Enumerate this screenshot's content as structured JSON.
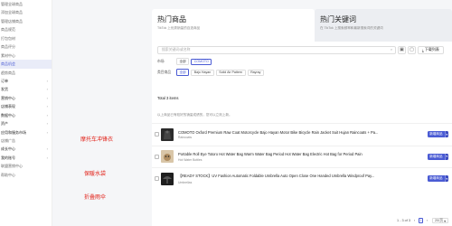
{
  "sidebar": {
    "items": [
      {
        "label": "管理全球商品",
        "type": "item"
      },
      {
        "label": "添加全球商品",
        "type": "item"
      },
      {
        "label": "管理店铺商品",
        "type": "item"
      },
      {
        "label": "商品规范",
        "type": "item"
      },
      {
        "label": "打包包材",
        "type": "item"
      },
      {
        "label": "商品评分",
        "type": "item"
      },
      {
        "label": "素材中心",
        "type": "item"
      },
      {
        "label": "商品机会",
        "type": "active"
      },
      {
        "label": "趋势商品",
        "type": "item"
      },
      {
        "label": "订单",
        "type": "group"
      },
      {
        "label": "发货",
        "type": "group"
      },
      {
        "label": "营销中心",
        "type": "group"
      },
      {
        "label": "店铺表现",
        "type": "group"
      },
      {
        "label": "数据中心",
        "type": "group"
      },
      {
        "label": "资产",
        "type": "group"
      },
      {
        "label": "应用和服务市场",
        "type": "group"
      },
      {
        "label": "店铺广告",
        "type": "item"
      },
      {
        "label": "成长中心",
        "type": "group"
      },
      {
        "label": "我的账号",
        "type": "group"
      },
      {
        "label": "联盟营销中心",
        "type": "item"
      },
      {
        "label": "帮助中心",
        "type": "item"
      }
    ]
  },
  "annotations": [
    "摩托车冲锋衣",
    "保暖水袋",
    "折叠雨伞"
  ],
  "tabs": [
    {
      "title": "热门商品",
      "subtitle": "TikTok 上优秀销量的自选商品"
    },
    {
      "title": "热门关键词",
      "subtitle": "在 TikTok 上搜索频率和最新搜索词的关键词"
    }
  ],
  "search": {
    "placeholder": "搜索关键词/或名称",
    "download_label": "下载列表"
  },
  "filters": [
    {
      "label": "市场",
      "chips": [
        {
          "text": "全部",
          "selected": false
        },
        {
          "text": "COMOTO",
          "selected": true
        }
      ]
    },
    {
      "label": "类目商品",
      "chips": [
        {
          "text": "全部",
          "selected": true
        },
        {
          "text": "Bajo Hayan",
          "selected": false
        },
        {
          "text": "Solid Air Pattern",
          "selected": false
        },
        {
          "text": "Rayray",
          "selected": false
        }
      ]
    }
  ],
  "total": "Total 3 items",
  "hint": "以上商品已有较好的销量成绩的，您可以立刻上新。",
  "products": [
    {
      "title": "COMOTO Oxford Premium Raw Coat Motorcycle Bajo Hayan Motor Bike Bicycle Rain Jacket Suit Hujan Raincoats + Pa...",
      "shop": "Raincoats",
      "thumb_color": "#2b2b2b"
    },
    {
      "title": "Portable Roll Eye Totoro Hot Water Bag Warm Water Bag Period Hot Water Bag Electric Hot Bag for Period Pain",
      "shop": "Hot Water Bottles",
      "thumb_color": "#d9c6a8"
    },
    {
      "title": "【READY STOCK】UV Fashion Automatic Foldable Umbrella Auto Open Close One Handed Umbrella Windproof Pay...",
      "shop": "Umbrellas",
      "thumb_color": "#1f1f1f"
    }
  ],
  "add_button_label": "新增商品",
  "pagination": {
    "range": "1 - 3 of 3",
    "current": "1",
    "page_size": "20/页"
  },
  "colors": {
    "accent": "#4a5bd4",
    "annotation": "#e2231a"
  }
}
